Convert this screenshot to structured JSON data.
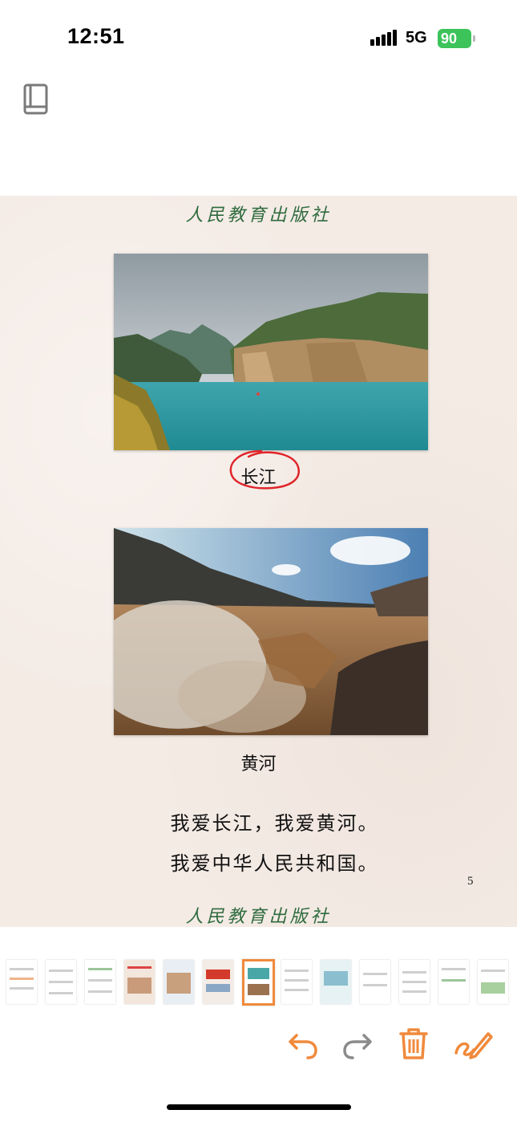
{
  "status_bar": {
    "time": "12:51",
    "network": "5G",
    "battery": "90"
  },
  "header": {
    "book_icon": "book-icon"
  },
  "page": {
    "publisher_top": "人民教育出版社",
    "publisher_bottom": "人民教育出版社",
    "photo_1_caption": "长江",
    "photo_2_caption": "黄河",
    "body_line_1": "我爱长江，我爱黄河。",
    "body_line_2": "我爱中华人民共和国。",
    "page_number": "5",
    "annotation_color": "#e0252b"
  },
  "thumbnails": {
    "count": 13,
    "active_index": 6,
    "accent_color": "#f08a3c"
  },
  "toolbar": {
    "undo_icon": "undo-icon",
    "redo_icon": "redo-icon",
    "delete_icon": "trash-icon",
    "draw_icon": "pen-icon",
    "accent_color": "#f08a3c"
  }
}
